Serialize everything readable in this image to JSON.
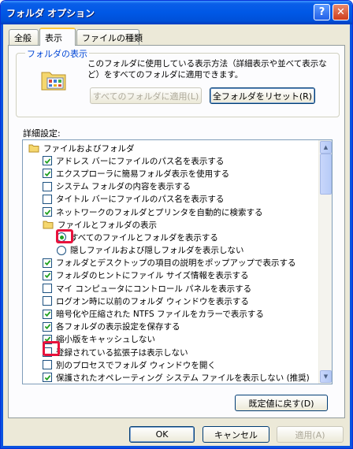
{
  "window": {
    "title": "フォルダ オプション",
    "help_glyph": "?",
    "close_glyph": "✕"
  },
  "tabs": [
    {
      "label": "全般"
    },
    {
      "label": "表示",
      "active": true
    },
    {
      "label": "ファイルの種類"
    }
  ],
  "folder_view": {
    "title": "フォルダの表示",
    "description": "このフォルダに使用している表示方法（詳細表示や並べて表示など）をすべてのフォルダに適用できます。",
    "apply_all_label": "すべてのフォルダに適用(L)",
    "reset_all_label": "全フォルダをリセット(R)"
  },
  "advanced": {
    "label": "詳細設定:",
    "rows": [
      {
        "type": "folder",
        "text": "ファイルおよびフォルダ",
        "indent": 0
      },
      {
        "type": "check",
        "checked": true,
        "text": "アドレス バーにファイルのパス名を表示する",
        "indent": 1
      },
      {
        "type": "check",
        "checked": true,
        "text": "エクスプローラに簡易フォルダ表示を使用する",
        "indent": 1
      },
      {
        "type": "check",
        "checked": false,
        "text": "システム フォルダの内容を表示する",
        "indent": 1
      },
      {
        "type": "check",
        "checked": false,
        "text": "タイトル バーにファイルのパス名を表示する",
        "indent": 1
      },
      {
        "type": "check",
        "checked": true,
        "text": "ネットワークのフォルダとプリンタを自動的に検索する",
        "indent": 1
      },
      {
        "type": "folder",
        "text": "ファイルとフォルダの表示",
        "indent": 1
      },
      {
        "type": "radio",
        "checked": true,
        "text": "すべてのファイルとフォルダを表示する",
        "indent": 2
      },
      {
        "type": "radio",
        "checked": false,
        "text": "隠しファイルおよび隠しフォルダを表示しない",
        "indent": 2
      },
      {
        "type": "check",
        "checked": true,
        "text": "フォルダとデスクトップの項目の説明をポップアップで表示する",
        "indent": 1
      },
      {
        "type": "check",
        "checked": true,
        "text": "フォルダのヒントにファイル サイズ情報を表示する",
        "indent": 1
      },
      {
        "type": "check",
        "checked": false,
        "text": "マイ コンピュータにコントロール パネルを表示する",
        "indent": 1
      },
      {
        "type": "check",
        "checked": false,
        "text": "ログオン時に以前のフォルダ ウィンドウを表示する",
        "indent": 1
      },
      {
        "type": "check",
        "checked": true,
        "text": "暗号化や圧縮された NTFS ファイルをカラーで表示する",
        "indent": 1
      },
      {
        "type": "check",
        "checked": true,
        "text": "各フォルダの表示設定を保存する",
        "indent": 1
      },
      {
        "type": "check",
        "checked": true,
        "text": "縮小版をキャッシュしない",
        "indent": 1
      },
      {
        "type": "check",
        "checked": false,
        "text": "登録されている拡張子は表示しない",
        "indent": 1
      },
      {
        "type": "check",
        "checked": false,
        "text": "別のプロセスでフォルダ ウィンドウを開く",
        "indent": 1
      },
      {
        "type": "check",
        "checked": true,
        "text": "保護されたオペレーティング システム ファイルを表示しない (推奨)",
        "indent": 1
      }
    ]
  },
  "restore_defaults_label": "既定値に戻す(D)",
  "footer": {
    "ok_label": "OK",
    "cancel_label": "キャンセル",
    "apply_label": "適用(A)"
  },
  "colors": {
    "title_bar": "#0058e6",
    "face": "#ece9d8",
    "check_mark": "#21a121",
    "highlight": "#e8123c"
  }
}
